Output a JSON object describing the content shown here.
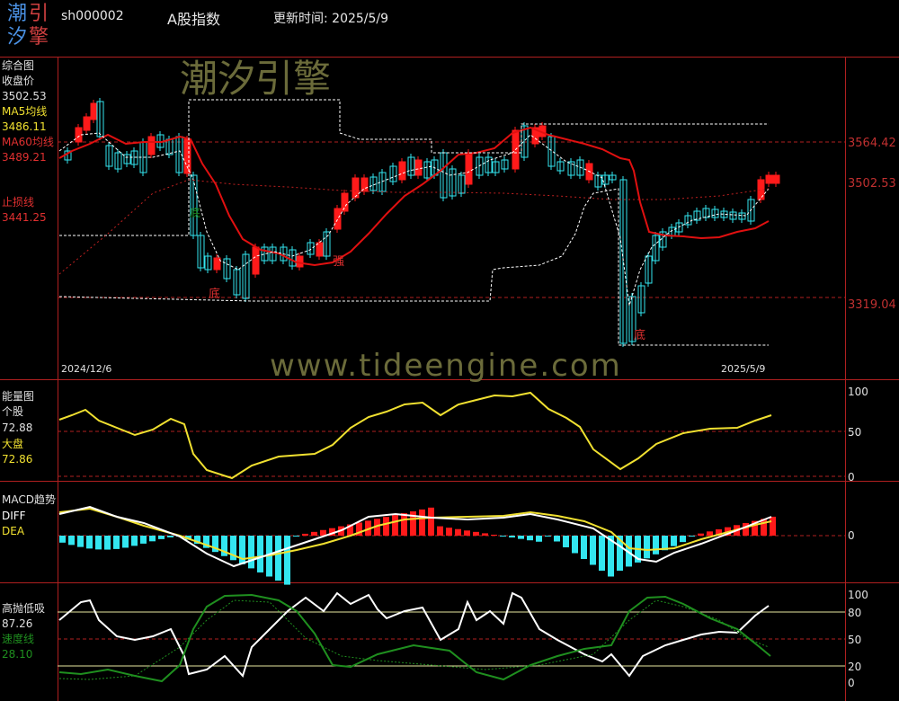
{
  "header": {
    "logo_chars": [
      "潮",
      "引",
      "汐",
      "擎"
    ],
    "symbol": "sh000002",
    "index_name": "A股指数",
    "update_label": "更新时间: 2025/5/9"
  },
  "watermark": {
    "brand_cn": "潮汐引擎",
    "url": "www.tideengine.com"
  },
  "panels": {
    "main": {
      "title": "综合图",
      "close_label": "收盘价",
      "close_value": "3502.53",
      "ma5_label": "MA5均线",
      "ma5_value": "3486.11",
      "ma60_label": "MA60均线",
      "ma60_value": "3489.21",
      "stop_label": "止损线",
      "stop_value": "3441.25",
      "date_start": "2024/12/6",
      "date_end": "2025/5/9",
      "axis_labels": [
        "3564.42",
        "3502.53",
        "3319.04"
      ],
      "annotations": [
        "底",
        "强",
        "底",
        "底"
      ]
    },
    "energy": {
      "title": "能量图",
      "stock_label": "个股",
      "stock_value": "72.88",
      "market_label": "大盘",
      "market_value": "72.86",
      "axis_labels": [
        "100",
        "50",
        "0"
      ]
    },
    "macd": {
      "title": "MACD趋势",
      "diff_label": "DIFF",
      "dea_label": "DEA",
      "axis_labels": [
        "0"
      ]
    },
    "hilo": {
      "title": "高抛低吸",
      "value": "87.26",
      "speed_label": "速度线",
      "speed_value": "28.10",
      "axis_labels": [
        "100",
        "80",
        "50",
        "20",
        "0"
      ]
    }
  },
  "colors": {
    "up": "#ff1a1a",
    "down": "#33e6f0",
    "ma60": "#e01010",
    "energy": "#f0e030",
    "diff": "#ffffff",
    "dea": "#f0e030",
    "hilo": "#ffffff",
    "speed": "#1f8f1f",
    "grid": "#b02020"
  }
}
